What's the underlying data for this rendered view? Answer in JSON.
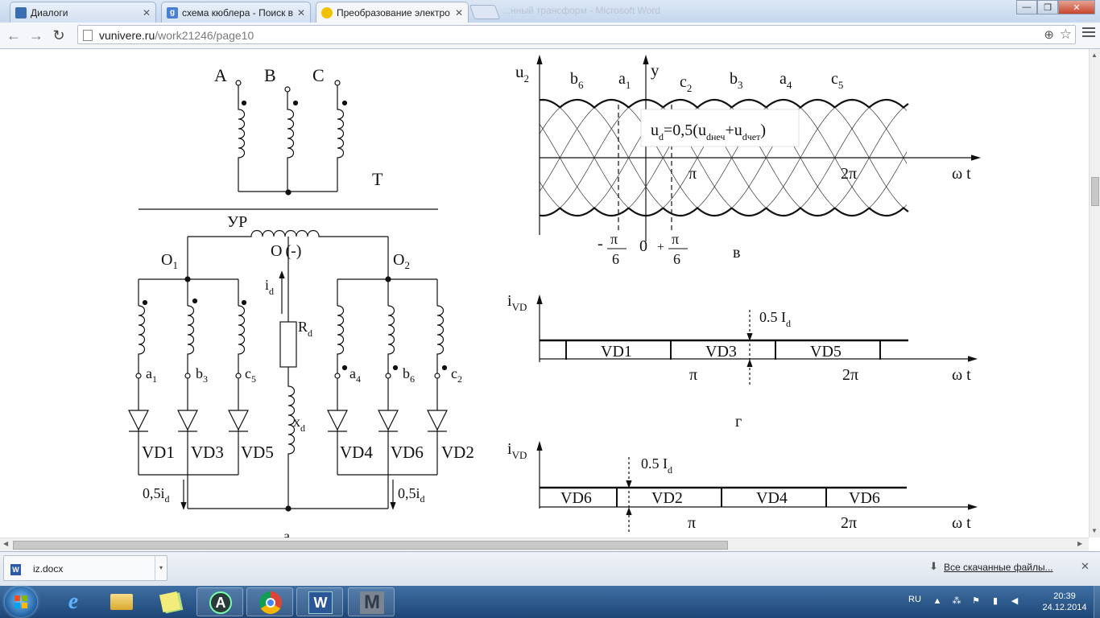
{
  "browser": {
    "tabs": [
      {
        "title": "Диалоги",
        "icon": "chat-bubble-icon",
        "color": "#3b6db3"
      },
      {
        "title": "схема кюблера - Поиск в",
        "icon": "google-icon",
        "color": "#4a80d4"
      },
      {
        "title": "Преобразование электро",
        "icon": "smiley-icon",
        "color": "#f2c200",
        "active": true
      }
    ],
    "ghost_title": "...нный трансформ - Microsoft Word",
    "window_controls": {
      "minimize": "—",
      "maximize": "❐",
      "close": "✕"
    },
    "nav": {
      "back": "←",
      "forward": "→",
      "reload": "↻"
    },
    "url": {
      "host": "vunivere.ru",
      "path": "/work21246/page10"
    }
  },
  "diagram": {
    "circuit": {
      "phases": [
        "A",
        "B",
        "C"
      ],
      "transformer_label": "T",
      "reactor_label": "УР",
      "node_o1": "O",
      "node_o1_sub": "1",
      "node_o2": "O",
      "node_o2_sub": "2",
      "node_o": "O",
      "node_o_sign": "(-)",
      "current_i": "i",
      "current_i_sub": "d",
      "resistor": "R",
      "resistor_sub": "d",
      "inductance": "x",
      "inductance_sub": "d",
      "windings_left": [
        {
          "l": "a",
          "s": "1"
        },
        {
          "l": "b",
          "s": "3"
        },
        {
          "l": "c",
          "s": "5"
        }
      ],
      "windings_right": [
        {
          "l": "a",
          "s": "4"
        },
        {
          "l": "b",
          "s": "6"
        },
        {
          "l": "c",
          "s": "2"
        }
      ],
      "diodes_left": [
        "VD1",
        "VD3",
        "VD5"
      ],
      "diodes_right": [
        "VD4",
        "VD6",
        "VD2"
      ],
      "half_current": "0,5i",
      "half_current_sub": "d",
      "caption": "а"
    },
    "voltage_plot": {
      "y_label": "u",
      "y_label_sub": "2",
      "y_axis": "y",
      "phase_labels": [
        {
          "l": "b",
          "s": "6"
        },
        {
          "l": "a",
          "s": "1"
        },
        {
          "l": "c",
          "s": "2"
        },
        {
          "l": "b",
          "s": "3"
        },
        {
          "l": "a",
          "s": "4"
        },
        {
          "l": "c",
          "s": "5"
        }
      ],
      "ud_formula": "u",
      "ud_formula_sub": "d",
      "ud_eq": "=0,5(u",
      "ud_sub1": "dнеч",
      "ud_plus": "+u",
      "ud_sub2": "dчет",
      "ud_close": ")",
      "pi": "π",
      "two_pi": "2π",
      "wt": "ω t",
      "minus": "-",
      "zero": "0",
      "plus": "+",
      "six": "6",
      "caption": "в"
    },
    "current_plot_1": {
      "y_label": "i",
      "y_label_sub": "VD",
      "half": "0.5 I",
      "half_sub": "d",
      "segments": [
        "VD1",
        "VD3",
        "VD5"
      ],
      "pi": "π",
      "two_pi": "2π",
      "wt": "ω t",
      "caption": "г"
    },
    "current_plot_2": {
      "y_label": "i",
      "y_label_sub": "VD",
      "half": "0.5 I",
      "half_sub": "d",
      "segments": [
        "VD6",
        "VD2",
        "VD4",
        "VD6"
      ],
      "pi": "π",
      "two_pi": "2π",
      "wt": "ω t"
    }
  },
  "downloads": {
    "item": "iz.docx",
    "item_icon": "W",
    "all_label": "Все скачанные файлы...",
    "close": "✕"
  },
  "taskbar": {
    "apps": [
      "internet-explorer",
      "file-explorer",
      "sticky-notes",
      "app-a",
      "chrome",
      "word",
      "mathcad"
    ],
    "app_a_letter": "A",
    "word_letter": "W",
    "mathcad_letter": "M",
    "lang": "RU",
    "time": "20:39",
    "date": "24.12.2014"
  }
}
